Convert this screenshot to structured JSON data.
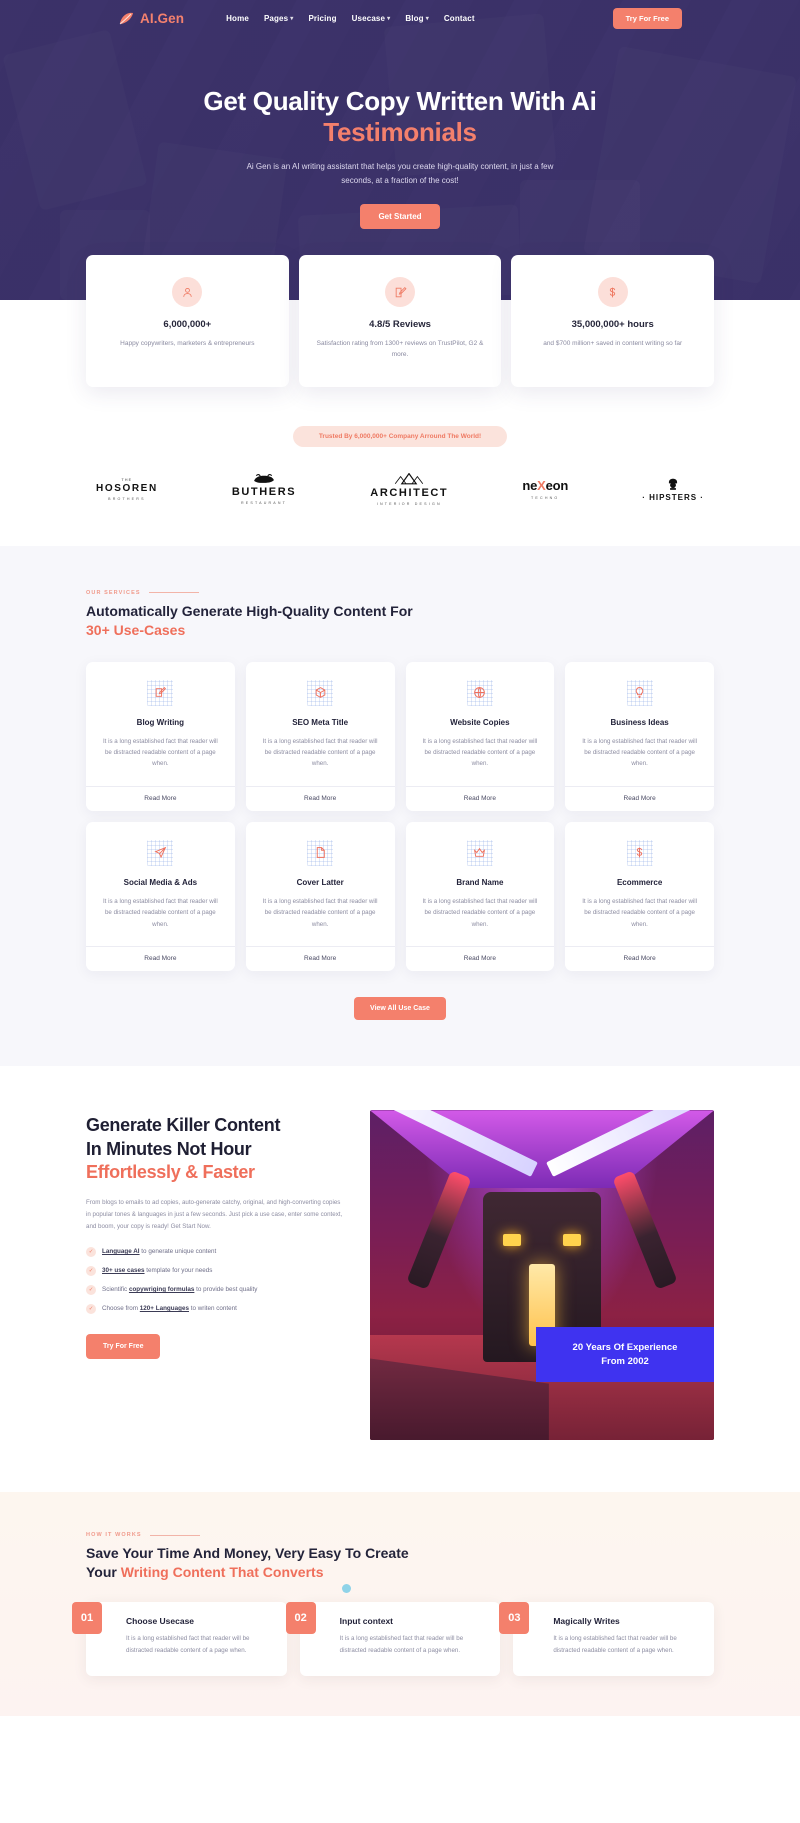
{
  "nav": {
    "brand": "AI.Gen",
    "links": [
      {
        "label": "Home",
        "caret": false
      },
      {
        "label": "Pages",
        "caret": true
      },
      {
        "label": "Pricing",
        "caret": false
      },
      {
        "label": "Usecase",
        "caret": true
      },
      {
        "label": "Blog",
        "caret": true
      },
      {
        "label": "Contact",
        "caret": false
      }
    ],
    "cta": "Try For Free"
  },
  "hero": {
    "title_line1": "Get Quality Copy Written With Ai",
    "title_accent": "Testimonials",
    "subtitle": "Ai Gen is an AI writing assistant that helps you create high-quality content, in just a few seconds, at a fraction of the cost!",
    "cta": "Get Started"
  },
  "stats": [
    {
      "icon": "user-icon",
      "number": "6,000,000+",
      "desc": "Happy copywriters, marketers & entrepreneurs"
    },
    {
      "icon": "edit-square-icon",
      "number": "4.8/5 Reviews",
      "desc": "Satisfaction rating from 1300+ reviews on TrustPilot, G2 & more."
    },
    {
      "icon": "dollar-icon",
      "number": "35,000,000+ hours",
      "desc": "and $700 million+ saved in content writing so far"
    }
  ],
  "trusted": {
    "pill": "Trusted By 6,000,000+ Company Arround The World!",
    "logos": [
      {
        "top": "THE",
        "main": "HOSOREN",
        "sub": "BROTHERS"
      },
      {
        "top": "",
        "main": "BUTHERS",
        "sub": "RESTAURANT"
      },
      {
        "top": "",
        "main": "ARCHITECT",
        "sub": "INTERIOR DESIGN"
      },
      {
        "top": "",
        "main": "neXeon",
        "sub": "TECHNO"
      },
      {
        "top": "",
        "main": "HIPSTERS",
        "sub": ""
      }
    ]
  },
  "services": {
    "eyebrow": "OUR SERVICES",
    "title": "Automatically Generate High-Quality Content For",
    "title_accent": "30+ Use-Cases",
    "read_more": "Read More",
    "view_all": "View All Use Case",
    "cards": [
      {
        "icon": "edit-square-icon",
        "title": "Blog Writing",
        "text": "It is a long established fact that reader will be distracted readable content of a page when."
      },
      {
        "icon": "box-icon",
        "title": "SEO Meta Title",
        "text": "It is a long established fact that reader will be distracted readable content of a page when."
      },
      {
        "icon": "globe-icon",
        "title": "Website Copies",
        "text": "It is a long established fact that reader will be distracted readable content of a page when."
      },
      {
        "icon": "bulb-icon",
        "title": "Business Ideas",
        "text": "It is a long established fact that reader will be distracted readable content of a page when."
      },
      {
        "icon": "send-icon",
        "title": "Social Media & Ads",
        "text": "It is a long established fact that reader will be distracted readable content of a page when."
      },
      {
        "icon": "document-icon",
        "title": "Cover Latter",
        "text": "It is a long established fact that reader will be distracted readable content of a page when."
      },
      {
        "icon": "crown-icon",
        "title": "Brand Name",
        "text": "It is a long established fact that reader will be distracted readable content of a page when."
      },
      {
        "icon": "dollar-icon",
        "title": "Ecommerce",
        "text": "It is a long established fact that reader will be distracted readable content of a page when."
      }
    ]
  },
  "killer": {
    "title_line1": "Generate Killer Content",
    "title_line2": "In Minutes Not Hour",
    "title_accent": "Effortlessly & Faster",
    "paragraph": "From blogs to emails to ad copies, auto-generate catchy, original, and high-converting copies in popular tones & languages in just a few seconds. Just pick a use case, enter some context, and boom, your copy is ready! Get Start Now.",
    "checks": [
      {
        "link": "Language AI",
        "rest": " to generate unique content"
      },
      {
        "link": "30+ use cases",
        "rest": " template for your needs"
      },
      {
        "pre": "Scientific ",
        "link": "copywriging formulas",
        "rest": " to provide best quality"
      },
      {
        "pre": "Choose from ",
        "link": "120+ Languages",
        "rest": " to writen content"
      }
    ],
    "cta": "Try For Free",
    "badge_line1": "20 Years Of Experience",
    "badge_line2": "From 2002"
  },
  "howworks": {
    "eyebrow": "HOW IT WORKS",
    "title_line1": "Save Your Time And Money, Very Easy To Create",
    "title_line2_pre": "Your ",
    "title_accent": "Writing Content That Converts",
    "steps": [
      {
        "num": "01",
        "title": "Choose Usecase",
        "text": "It is a long established fact that reader will be distracted readable content of a page when."
      },
      {
        "num": "02",
        "title": "Input context",
        "text": "It is a long established fact that reader will be distracted readable content of a page when."
      },
      {
        "num": "03",
        "title": "Magically Writes",
        "text": "It is a long established fact that reader will be distracted readable content of a page when."
      }
    ]
  },
  "colors": {
    "accent": "#f4806c",
    "accent_dark": "#ef6f5b",
    "hero_bg": "#3c3468",
    "badge_blue": "#3f33f0"
  }
}
